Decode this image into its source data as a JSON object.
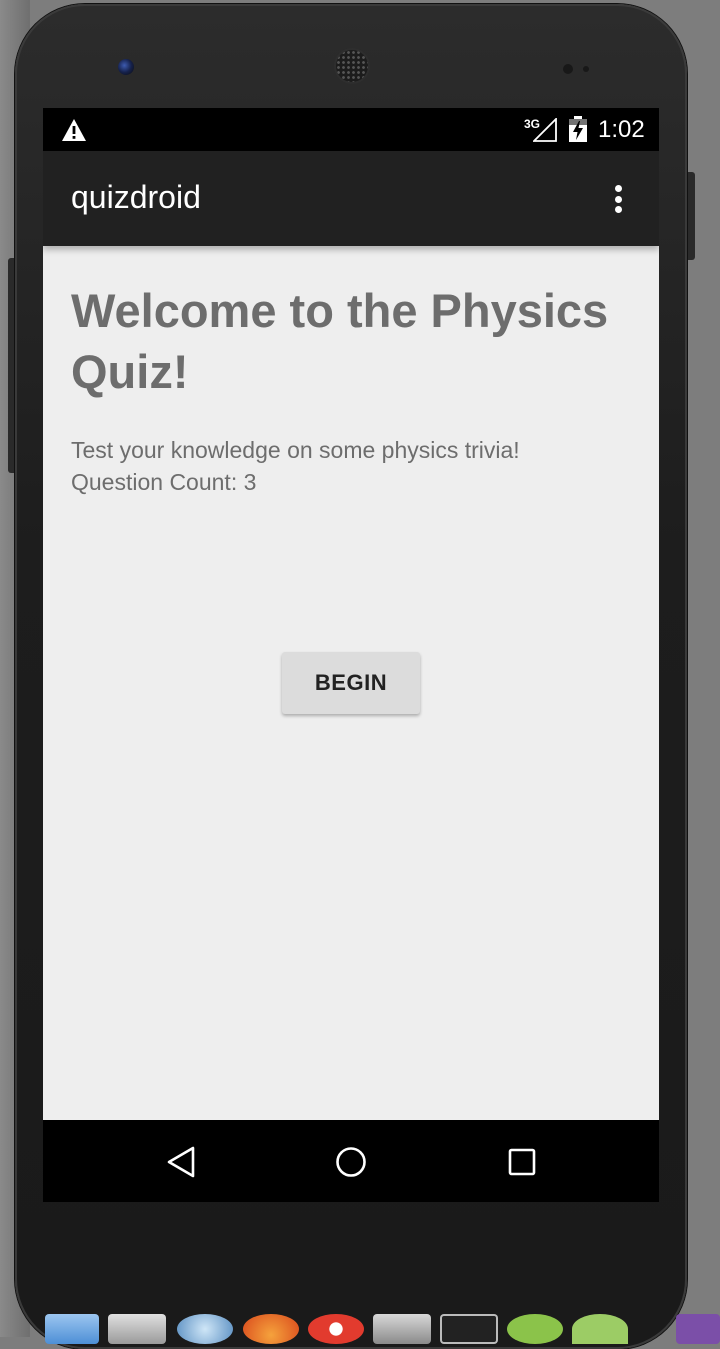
{
  "status_bar": {
    "network_label": "3G",
    "time": "1:02",
    "icons": [
      "warning-icon",
      "signal-icon",
      "battery-charging-icon"
    ]
  },
  "app_bar": {
    "title": "quizdroid",
    "menu_icon": "overflow-menu-icon"
  },
  "main": {
    "heading": "Welcome to the Physics Quiz!",
    "description": "Test your knowledge on some physics trivia!",
    "question_count_label": "Question Count: 3",
    "begin_button_label": "BEGIN"
  },
  "nav_bar": {
    "icons": [
      "back-icon",
      "home-icon",
      "recents-icon"
    ]
  },
  "colors": {
    "screen_background": "#eeeeee",
    "app_bar_background": "#212121",
    "text_gray": "#6d6d6d",
    "button_background": "#dcdcdc",
    "status_bar_background": "#000000"
  }
}
